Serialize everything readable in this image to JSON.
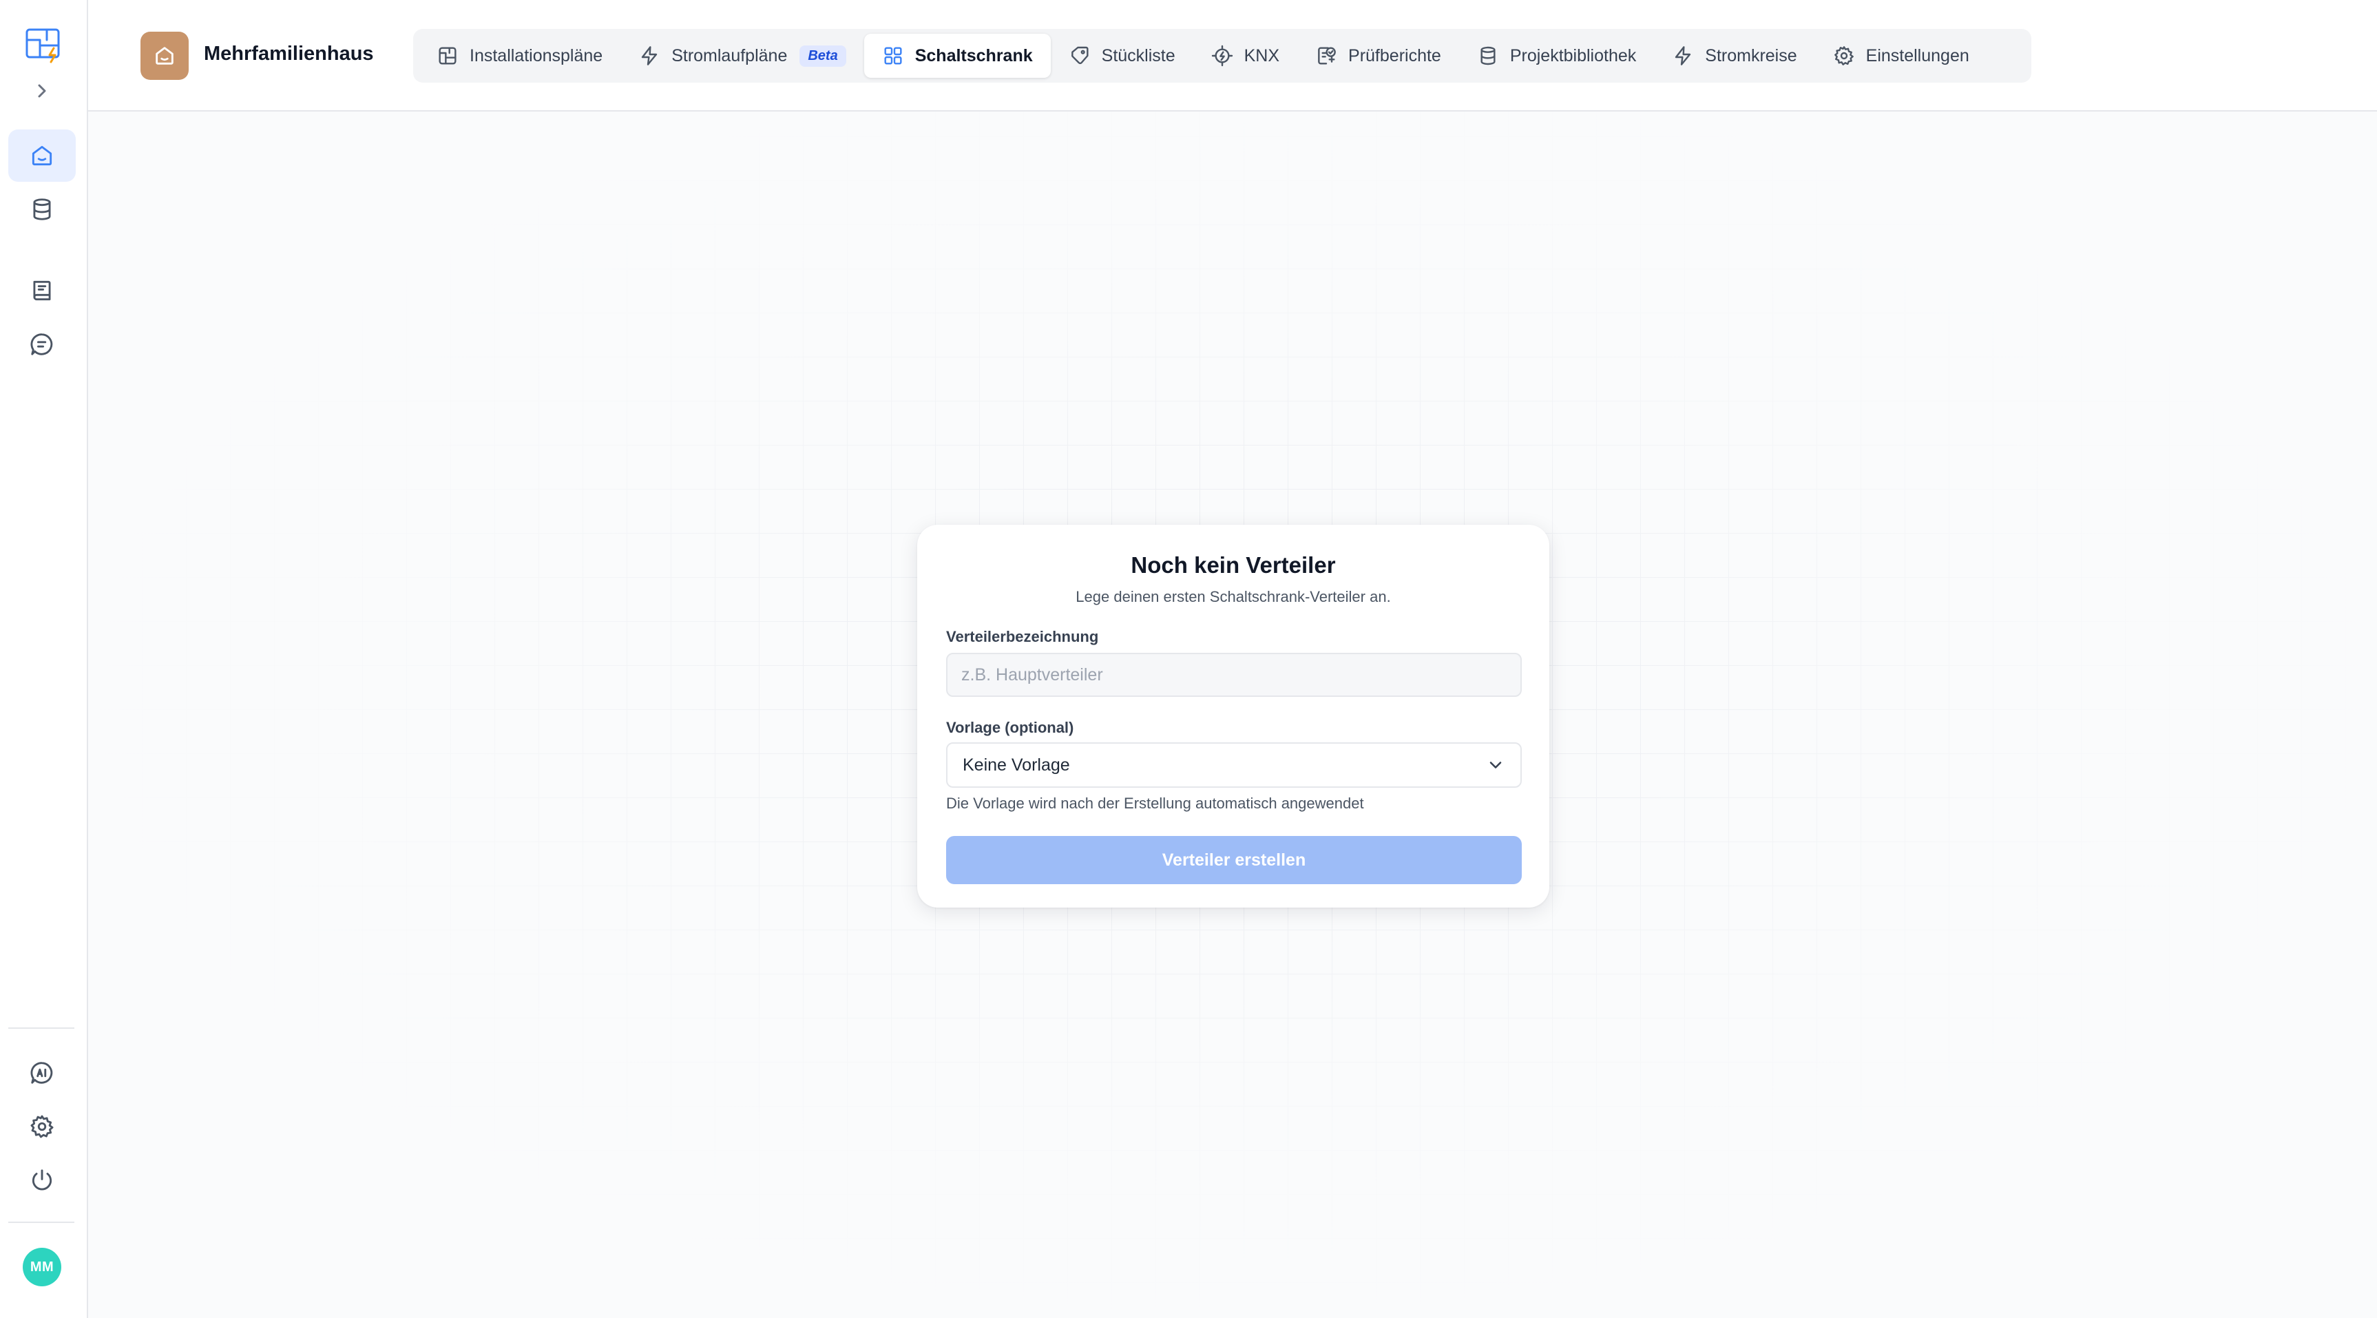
{
  "project": {
    "title": "Mehrfamilienhaus",
    "icon": "home-icon",
    "icon_color": "#c8946a"
  },
  "sidebar": {
    "logo": "app-logo-icon",
    "expand_icon": "chevron-right-icon",
    "top_items": [
      {
        "icon": "home-icon",
        "active": true
      },
      {
        "icon": "database-icon",
        "active": false
      },
      {
        "icon": "book-icon",
        "active": false
      },
      {
        "icon": "chat-icon",
        "active": false
      }
    ],
    "bottom_items": [
      {
        "icon": "ai-icon"
      },
      {
        "icon": "gear-icon"
      },
      {
        "icon": "power-icon"
      }
    ],
    "avatar": {
      "initials": "MM",
      "color": "#2dd4bf"
    }
  },
  "tabs": [
    {
      "label": "Installationspläne",
      "icon": "blueprint-icon",
      "active": false
    },
    {
      "label": "Stromlaufpläne",
      "icon": "lightning-icon",
      "badge": "Beta",
      "active": false
    },
    {
      "label": "Schaltschrank",
      "icon": "grid-icon",
      "active": true
    },
    {
      "label": "Stückliste",
      "icon": "tag-icon",
      "active": false
    },
    {
      "label": "KNX",
      "icon": "chip-icon",
      "active": false
    },
    {
      "label": "Prüfberichte",
      "icon": "report-check-icon",
      "active": false
    },
    {
      "label": "Projektbibliothek",
      "icon": "database-icon",
      "active": false
    },
    {
      "label": "Stromkreise",
      "icon": "lightning-icon",
      "active": false
    },
    {
      "label": "Einstellungen",
      "icon": "gear-icon",
      "active": false
    }
  ],
  "dialog": {
    "title": "Noch kein Verteiler",
    "subtitle": "Lege deinen ersten Schaltschrank-Verteiler an.",
    "name_label": "Verteilerbezeichnung",
    "name_placeholder": "z.B. Hauptverteiler",
    "name_value": "",
    "template_label": "Vorlage (optional)",
    "template_value": "Keine Vorlage",
    "template_hint": "Die Vorlage wird nach der Erstellung automatisch angewendet",
    "submit_label": "Verteiler erstellen",
    "submit_color": "#9dbcf7"
  },
  "colors": {
    "accent": "#3b82f6",
    "active_bg": "#e8efff"
  }
}
